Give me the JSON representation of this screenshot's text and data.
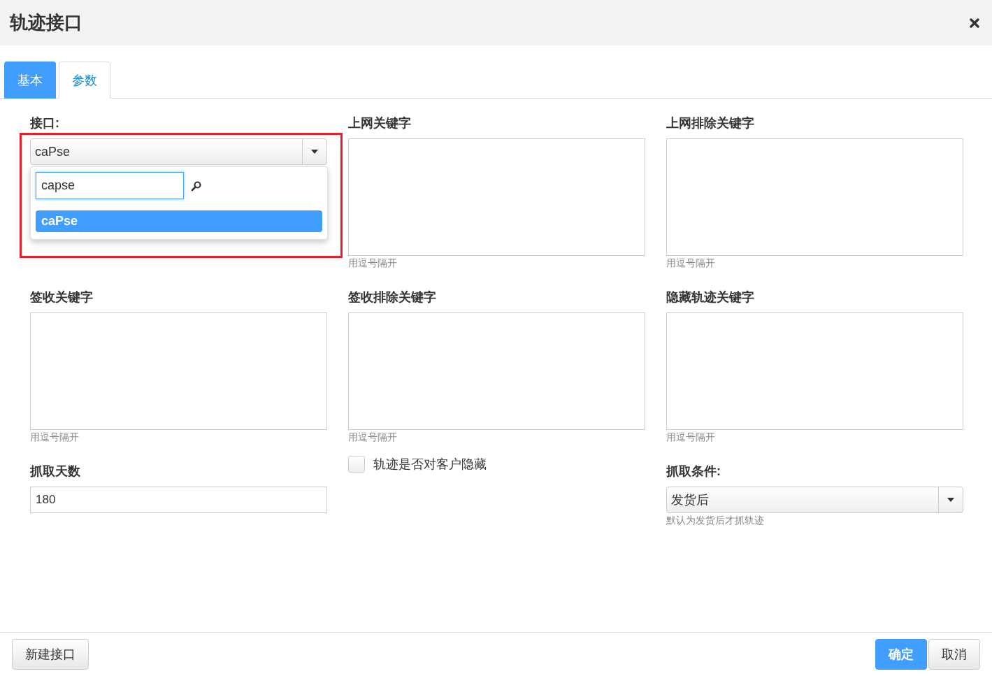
{
  "dialog": {
    "title": "轨迹接口"
  },
  "tabs": [
    {
      "label": "基本",
      "selected": true
    },
    {
      "label": "参数",
      "selected": false
    }
  ],
  "fields": [
    {
      "kind": "select",
      "label": "接口:",
      "value": "caPse",
      "dropdown": {
        "search": "capse",
        "options": [
          {
            "label": "caPse",
            "selected": true
          }
        ]
      }
    },
    {
      "kind": "textarea",
      "label": "上网关键字",
      "hint": "用逗号隔开"
    },
    {
      "kind": "textarea",
      "label": "上网排除关键字",
      "hint": "用逗号隔开"
    },
    {
      "kind": "textarea",
      "label": "签收关键字",
      "hint": "用逗号隔开"
    },
    {
      "kind": "textarea",
      "label": "签收排除关键字",
      "hint": "用逗号隔开"
    },
    {
      "kind": "textarea",
      "label": "隐藏轨迹关键字",
      "hint": "用逗号隔开"
    },
    {
      "kind": "input",
      "label": "抓取天数",
      "value": "180"
    },
    {
      "kind": "checkbox",
      "label": "轨迹是否对客户隐藏",
      "checked": false
    },
    {
      "kind": "select",
      "label": "抓取条件:",
      "value": "发货后",
      "hint": "默认为发货后才抓轨迹"
    }
  ],
  "footer": {
    "left_buttons": [
      {
        "label": "新建接口",
        "primary": false
      }
    ],
    "right_buttons": [
      {
        "label": "确定",
        "primary": true
      },
      {
        "label": "取消",
        "primary": false
      }
    ]
  }
}
